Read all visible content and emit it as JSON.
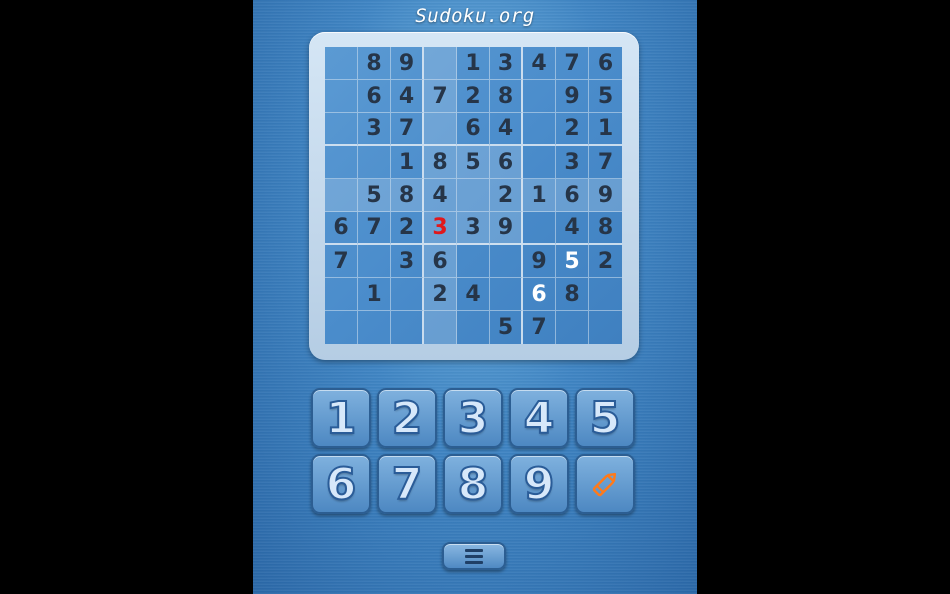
{
  "app": {
    "title": "Sudoku.org"
  },
  "board": {
    "rows": [
      [
        "",
        "8",
        "9",
        "",
        "1",
        "3",
        "4",
        "7",
        "6"
      ],
      [
        "",
        "6",
        "4",
        "7",
        "2",
        "8",
        "",
        "9",
        "5"
      ],
      [
        "",
        "3",
        "7",
        "",
        "6",
        "4",
        "",
        "2",
        "1"
      ],
      [
        "",
        "",
        "1",
        "8",
        "5",
        "6",
        "",
        "3",
        "7"
      ],
      [
        "",
        "5",
        "8",
        "4",
        "",
        "2",
        "1",
        "6",
        "9"
      ],
      [
        "6",
        "7",
        "2",
        "3",
        "3",
        "9",
        "",
        "4",
        "8"
      ],
      [
        "7",
        "",
        "3",
        "6",
        "",
        "",
        "9",
        "5",
        "2"
      ],
      [
        "",
        "1",
        "",
        "2",
        "4",
        "",
        "6",
        "8",
        ""
      ],
      [
        "",
        "",
        "",
        "",
        "",
        "5",
        "7",
        "",
        ""
      ]
    ],
    "error_cells": [
      [
        5,
        3
      ]
    ],
    "user_cells": [
      [
        6,
        7
      ],
      [
        7,
        6
      ]
    ],
    "highlight": {
      "row": 4,
      "col": 3
    }
  },
  "keypad": {
    "keys": [
      "1",
      "2",
      "3",
      "4",
      "5",
      "6",
      "7",
      "8",
      "9"
    ],
    "pencil_icon": "pencil-icon"
  },
  "menu": {
    "icon": "hamburger-menu-icon"
  },
  "colors": {
    "given_digit": "#263548",
    "error_digit": "#e0181c",
    "user_digit": "#ffffff",
    "pencil_orange": "#ff7a1a"
  }
}
